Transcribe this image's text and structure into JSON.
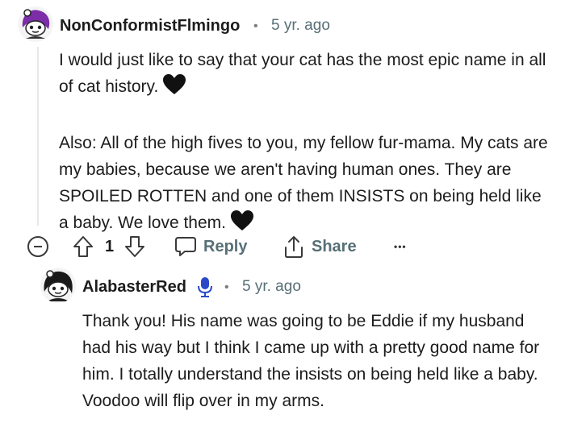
{
  "comment1": {
    "author": "NonConformistFlmingo",
    "separator": "•",
    "age": "5 yr. ago",
    "paragraphs": [
      "I would just like to say that your cat has the most epic name in all of cat history.",
      "Also: All of the high fives to you, my fellow fur-mama. My cats are my babies, because we aren't having human ones. They are SPOILED ROTTEN and one of them INSISTS on being held like a baby. We love them."
    ],
    "vote_count": "1",
    "reply_label": "Reply",
    "share_label": "Share",
    "more_label": "•••"
  },
  "comment2": {
    "author": "AlabasterRed",
    "separator": "•",
    "age": "5 yr. ago",
    "text": "Thank you! His name was going to be Eddie if my husband had his way but I think I came up with a pretty good name for him. I totally understand the insists on being held like a baby. Voodoo will flip over in my arms."
  },
  "colors": {
    "accent_voice": "#2a49c9",
    "meta_grey": "#576f76",
    "avatar1_hair": "#7b2ea8"
  },
  "icons": [
    "collapse-icon",
    "upvote-icon",
    "downvote-icon",
    "reply-bubble-icon",
    "share-icon",
    "more-dots-icon",
    "microphone-icon",
    "heart-emoji"
  ]
}
